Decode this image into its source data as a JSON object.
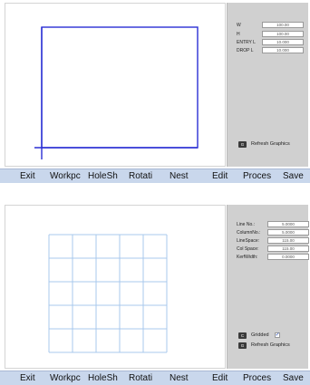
{
  "toolbar": {
    "buttons": [
      "Exit",
      "Workpc",
      "HoleSh",
      "Rotati",
      "Nest",
      "Edit",
      "Proces",
      "Save"
    ]
  },
  "panel1": {
    "fields": [
      {
        "label": "W",
        "value": "100.00"
      },
      {
        "label": "H",
        "value": "100.00"
      },
      {
        "label": "ENTRY L",
        "value": "10.000"
      },
      {
        "label": "DROP L",
        "value": "10.000"
      }
    ],
    "refresh_button": {
      "key": "G",
      "label": "Refresh Graphics"
    }
  },
  "panel2": {
    "fields": [
      {
        "label": "Line No.:",
        "value": "5.0000"
      },
      {
        "label": "ColumnNo.:",
        "value": "5.0000"
      },
      {
        "label": "LineSpace:",
        "value": "115.00"
      },
      {
        "label": "Col Space:",
        "value": "115.00"
      },
      {
        "label": "KerfWidth:",
        "value": "0.0000"
      }
    ],
    "gridded": {
      "key": "C",
      "label": "Gridded",
      "checked": true,
      "mark": "✓"
    },
    "refresh_button": {
      "key": "G",
      "label": "Refresh Graphics"
    }
  },
  "colors": {
    "toolbar_bg": "#c9d7ec",
    "side_bg": "#d0d0d0",
    "rect_stroke": "#2a2fd4",
    "grid_stroke": "#a9c8ec"
  }
}
